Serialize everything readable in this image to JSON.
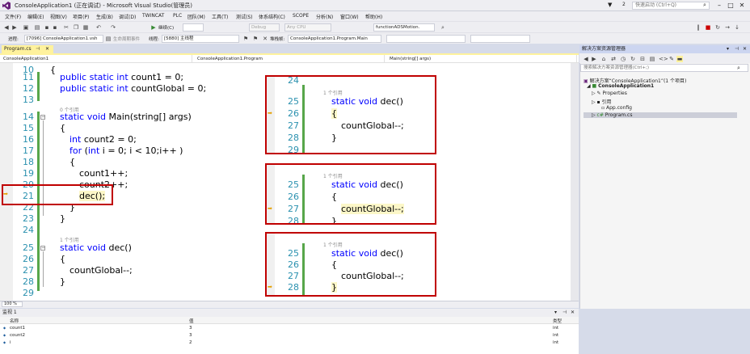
{
  "window": {
    "title": "ConsoleApplication1 (正在调试) - Microsoft Visual Studio(管理员)",
    "quick_launch_placeholder": "快速启动 (Ctrl+Q)",
    "badge": "2"
  },
  "menu": [
    "文件(F)",
    "编辑(E)",
    "视图(V)",
    "项目(P)",
    "生成(B)",
    "调试(D)",
    "TWINCAT",
    "PLC",
    "团队(M)",
    "工具(T)",
    "测试(S)",
    "体系结构(C)",
    "SCOPE",
    "分析(N)",
    "窗口(W)",
    "帮助(H)"
  ],
  "toolbar1": {
    "continue_label": "继续(C)",
    "config": "Debug",
    "platform": "Any CPU",
    "find": "functionADSMotion."
  },
  "toolbar2": {
    "process_label": "进程:",
    "process": "[7096] ConsoleApplication1.vsh",
    "lifecycle_label": "生命周期事件",
    "thread_label": "线程:",
    "thread": "[5880] 主线程",
    "stack_label": "堆栈帧:",
    "stack": "ConsoleApplication1.Program.Main"
  },
  "doc_tab": "Program.cs",
  "navbar": {
    "project": "ConsoleApplication1",
    "class": "ConsoleApplication1.Program",
    "member": "Main(string[] args)"
  },
  "editor": {
    "lines": [
      {
        "n": "10",
        "text": "{"
      },
      {
        "n": "11",
        "kw": "public static int",
        "rest": " count1 = 0;"
      },
      {
        "n": "12",
        "kw": "public static int",
        "rest": " countGlobal = 0;"
      },
      {
        "n": "13",
        "text": ""
      },
      {
        "n": "14",
        "kw": "static void",
        "rest": " Main(string[] args)"
      },
      {
        "n": "15",
        "text": "{"
      },
      {
        "n": "16",
        "kw": "int",
        "rest": " count2 = 0;"
      },
      {
        "n": "17",
        "kw": "for",
        "rest": " (",
        "kw2": "int",
        "rest2": " i = 0; i < 10;i++ )"
      },
      {
        "n": "18",
        "text": "{"
      },
      {
        "n": "19",
        "text": "count1++;"
      },
      {
        "n": "20",
        "text": "count2++;"
      },
      {
        "n": "21",
        "text": "dec();"
      },
      {
        "n": "22",
        "text": "}"
      },
      {
        "n": "23",
        "text": "}"
      },
      {
        "n": "24",
        "text": ""
      },
      {
        "n": "25",
        "kw": "static void",
        "rest": " dec()"
      },
      {
        "n": "26",
        "text": "{"
      },
      {
        "n": "27",
        "text": "countGlobal--;"
      },
      {
        "n": "28",
        "text": "}"
      },
      {
        "n": "29",
        "text": ""
      }
    ],
    "ref_main": "0 个引用",
    "ref_dec": "1 个引用"
  },
  "insets": [
    {
      "lines": [
        {
          "n": "24",
          "text": ""
        },
        {
          "n": "25",
          "kw": "static void",
          "rest": " dec()"
        },
        {
          "n": "26",
          "text": "{"
        },
        {
          "n": "27",
          "text": "countGlobal--;"
        },
        {
          "n": "28",
          "text": "}"
        },
        {
          "n": "29",
          "text": ""
        }
      ],
      "ref": "1 个引用"
    },
    {
      "lines": [
        {
          "n": "25",
          "kw": "static void",
          "rest": " dec()"
        },
        {
          "n": "26",
          "text": "{"
        },
        {
          "n": "27",
          "text": "countGlobal--;"
        },
        {
          "n": "28",
          "text": "}"
        }
      ],
      "ref": "1 个引用"
    },
    {
      "lines": [
        {
          "n": "25",
          "kw": "static void",
          "rest": " dec()"
        },
        {
          "n": "26",
          "text": "{"
        },
        {
          "n": "27",
          "text": "countGlobal--;"
        },
        {
          "n": "28",
          "text": "}"
        }
      ],
      "ref": "1 个引用"
    }
  ],
  "zoom": "100 %",
  "solution_explorer": {
    "title": "解决方案资源管理器",
    "search_placeholder": "搜索解决方案资源管理器(Ctrl+;)",
    "items": [
      {
        "label": "解决方案“ConsoleApplication1”(1 个项目)"
      },
      {
        "label": "ConsoleApplication1"
      },
      {
        "label": "Properties"
      },
      {
        "label": "引用"
      },
      {
        "label": "App.config"
      },
      {
        "label": "Program.cs"
      }
    ]
  },
  "watch": {
    "title": "监视 1",
    "columns": [
      "名称",
      "值",
      "类型"
    ],
    "rows": [
      {
        "name": "count1",
        "value": "3",
        "type": "int"
      },
      {
        "name": "count2",
        "value": "3",
        "type": "int"
      },
      {
        "name": "i",
        "value": "2",
        "type": "int"
      }
    ]
  },
  "colors": {
    "accent": "#68217a",
    "highlight_tab": "#fff29d",
    "red_box": "#c00000",
    "keyword": "#0000ff",
    "line_number": "#2b91af",
    "change_bar": "#57a64a"
  }
}
